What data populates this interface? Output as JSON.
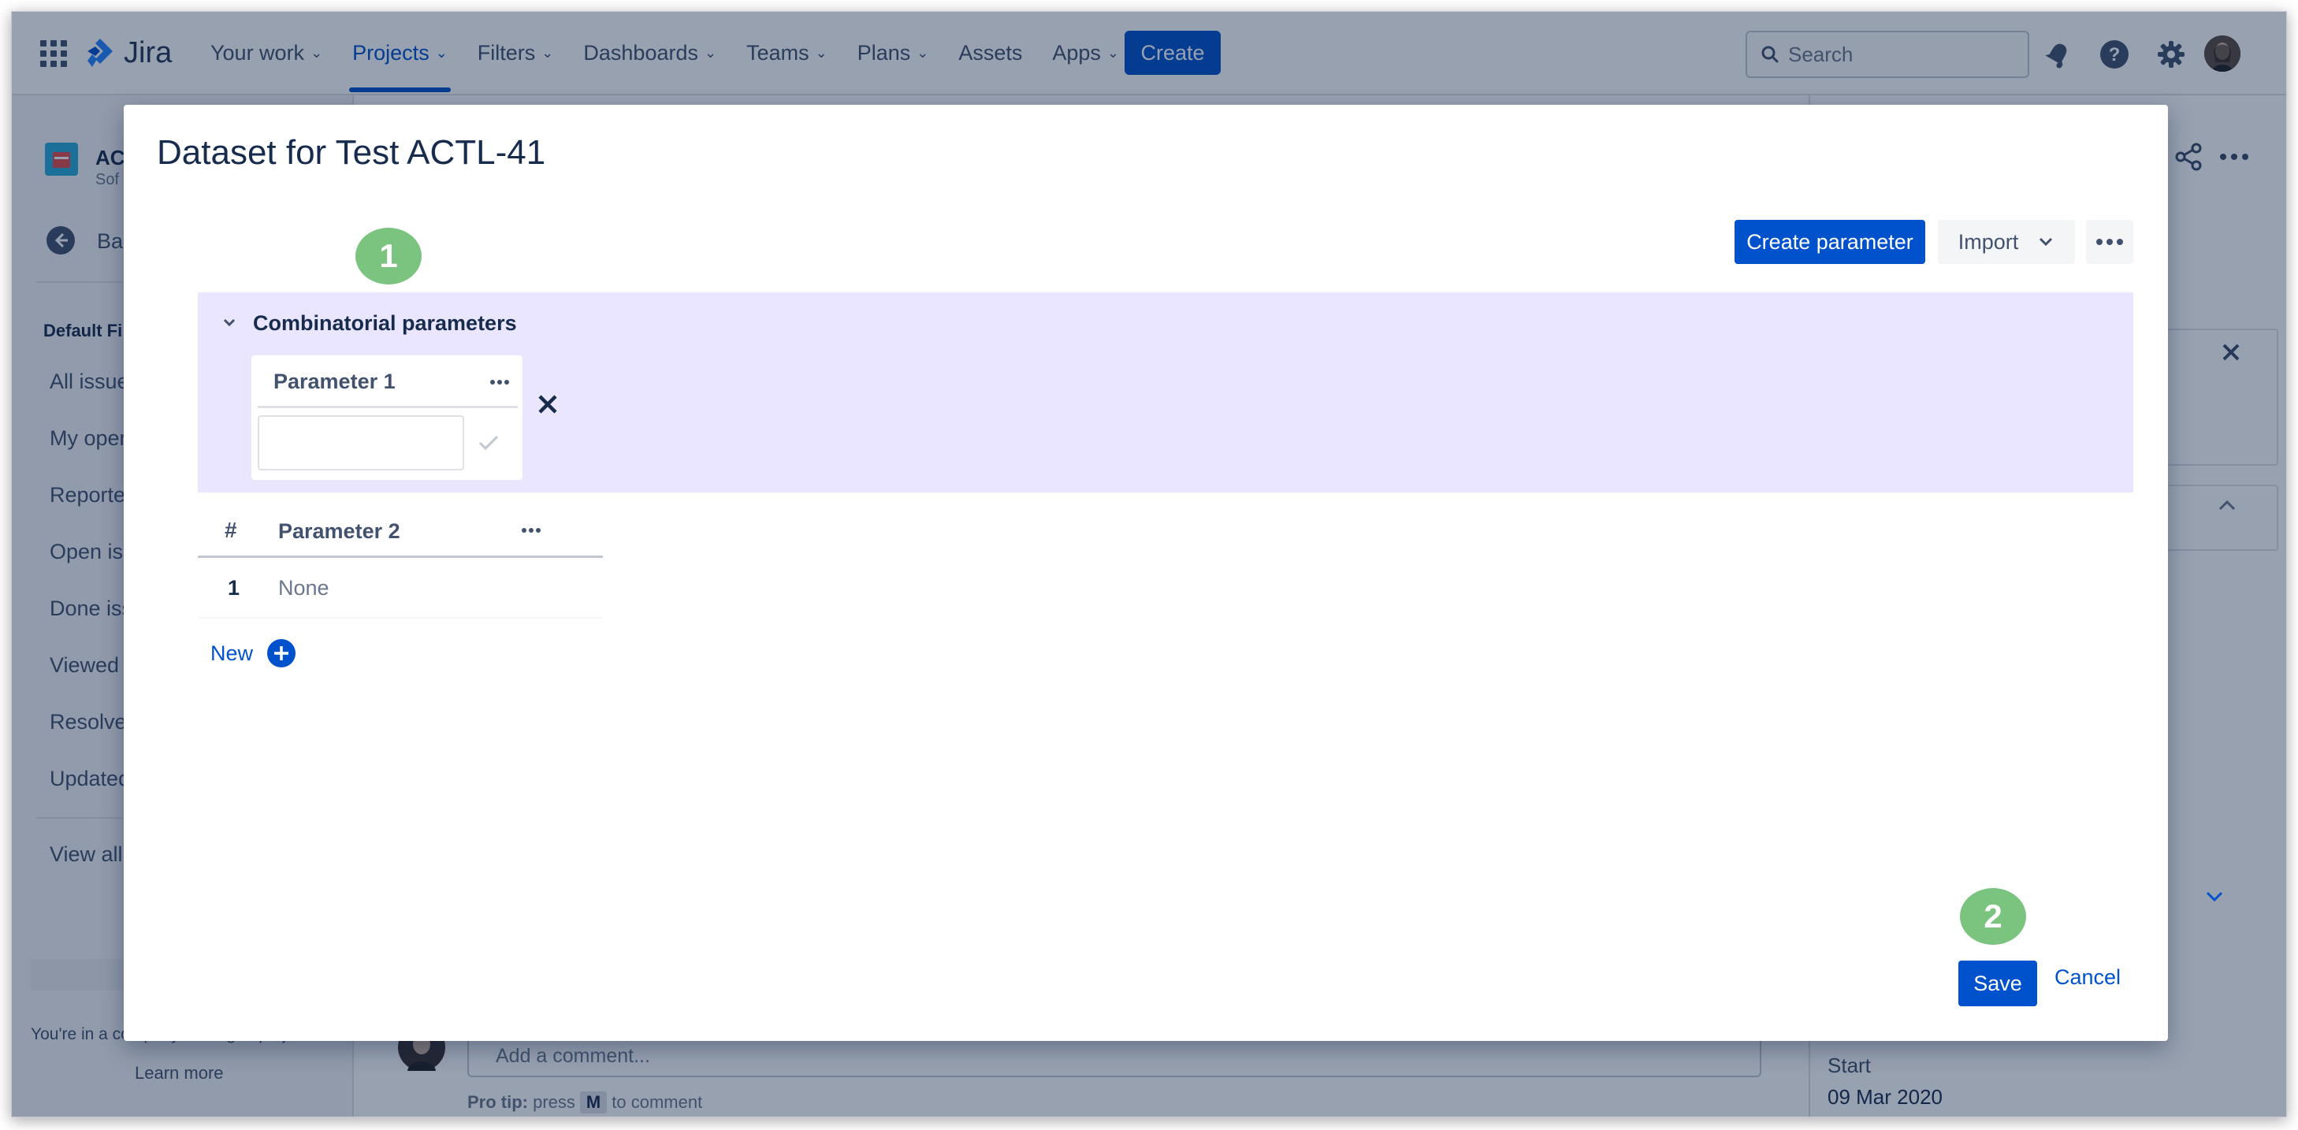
{
  "topnav": {
    "app_name": "Jira",
    "items": [
      {
        "label": "Your work",
        "dropdown": true,
        "active": false
      },
      {
        "label": "Projects",
        "dropdown": true,
        "active": true
      },
      {
        "label": "Filters",
        "dropdown": true,
        "active": false
      },
      {
        "label": "Dashboards",
        "dropdown": true,
        "active": false
      },
      {
        "label": "Teams",
        "dropdown": true,
        "active": false
      },
      {
        "label": "Plans",
        "dropdown": true,
        "active": false
      },
      {
        "label": "Assets",
        "dropdown": false,
        "active": false
      },
      {
        "label": "Apps",
        "dropdown": true,
        "active": false
      }
    ],
    "create_label": "Create",
    "search_placeholder": "Search",
    "icons": [
      "notifications-icon",
      "help-icon",
      "settings-icon",
      "avatar"
    ],
    "accent": "#0052cc"
  },
  "sidebar": {
    "project_name_fragment": "AC",
    "project_type_fragment": "Sof",
    "back_fragment": "Bac",
    "section_fragment": "Default Fi",
    "items": [
      "All issue",
      "My oper",
      "Reporte",
      "Open iss",
      "Done iss",
      "Viewed r",
      "Resolve",
      "Updated"
    ],
    "view_all_fragment": "View all",
    "company_note": "You're in a company-managed project",
    "learn_more": "Learn more"
  },
  "background": {
    "comment_placeholder": "Add a comment...",
    "protip_bold": "Pro tip:",
    "protip_pre": "press",
    "protip_key": "M",
    "protip_post": "to comment",
    "start_label": "Start",
    "start_value": "09 Mar 2020"
  },
  "modal": {
    "title": "Dataset for Test ACTL-41",
    "badge_1": "1",
    "badge_2": "2",
    "create_parameter_label": "Create parameter",
    "import_label": "Import",
    "combinatorial_title": "Combinatorial parameters",
    "parameter_1_label": "Parameter 1",
    "parameter_1_value": "",
    "table": {
      "headers": [
        "#",
        "Parameter 2"
      ],
      "rows": [
        {
          "index": "1",
          "value": "None"
        }
      ]
    },
    "new_label": "New",
    "save_label": "Save",
    "cancel_label": "Cancel"
  }
}
